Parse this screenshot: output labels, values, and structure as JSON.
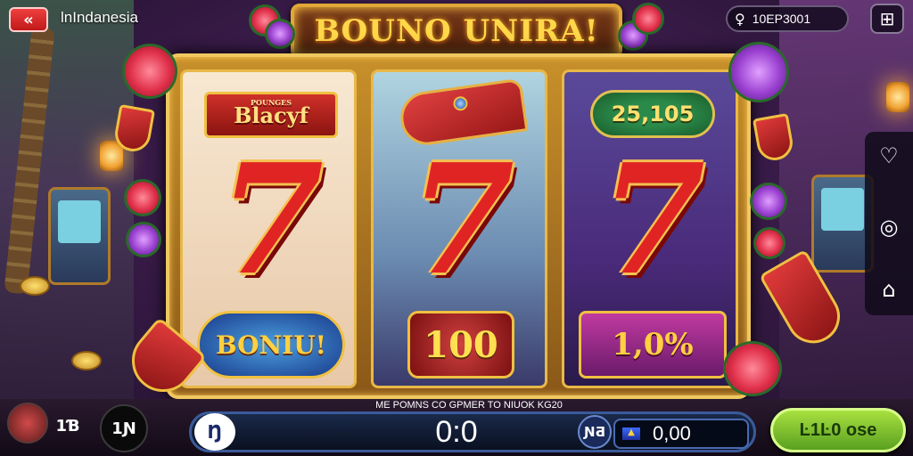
{
  "header": {
    "back_label": "«",
    "region": "lnIndanesia",
    "game_title": "BOUNO UNIRA!",
    "balance_icon": "♀",
    "balance_value": "10EP3001",
    "menu_label": "⊞"
  },
  "reels": [
    {
      "top_symbol": "Blacyf",
      "top_symbol_subtext": "POUNGES",
      "main_symbol": "7",
      "bottom_symbol": "BONIU!"
    },
    {
      "top_symbol": "hat",
      "main_symbol": "7",
      "bottom_symbol": "100"
    },
    {
      "top_symbol": "25,105",
      "main_symbol": "7",
      "bottom_symbol": "1,0%"
    }
  ],
  "side_menu": {
    "items": [
      {
        "icon": "heart-icon",
        "glyph": "♡"
      },
      {
        "icon": "settings-circle-icon",
        "glyph": "◎"
      },
      {
        "icon": "home-icon",
        "glyph": "⌂"
      }
    ]
  },
  "bottom_bar": {
    "sound_label": "1Ɓ",
    "auto_label": "1Ɲ",
    "info_text": "ME POMNS CO GPMER TO NIUOK KG20",
    "bet_minus_label": "Ŋ",
    "win_value": "0:0",
    "bet_plus_label": "ƝƋ",
    "credit_value": "0,00",
    "spin_label": "Ŀ1Ŀ0 ose"
  },
  "colors": {
    "accent_gold": "#f0c040",
    "seven_red": "#e02424",
    "spin_green": "#8cc83a"
  }
}
